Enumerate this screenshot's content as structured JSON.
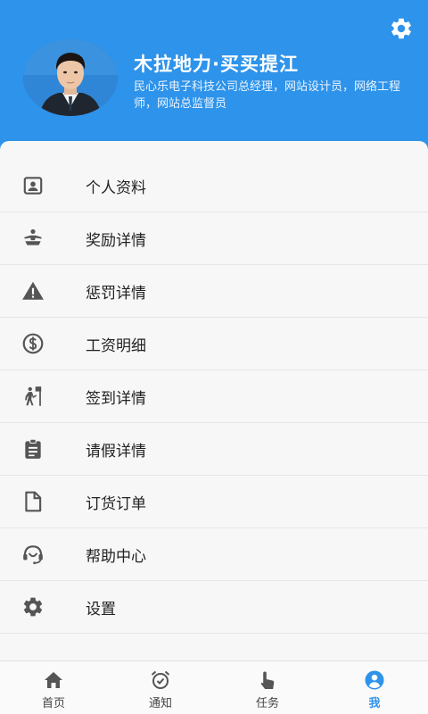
{
  "profile": {
    "name": "木拉地力·买买提江",
    "description": "民心乐电子科技公司总经理，网站设计员，网络工程师，网站总监督员"
  },
  "colors": {
    "header_bg": "#2e93ea",
    "icon_gray": "#555555",
    "active_tab": "#2e93ea"
  },
  "menu": {
    "items": [
      {
        "label": "个人资料",
        "icon": "id-card-icon"
      },
      {
        "label": "奖励详情",
        "icon": "award-icon"
      },
      {
        "label": "惩罚详情",
        "icon": "warning-icon"
      },
      {
        "label": "工资明细",
        "icon": "dollar-icon"
      },
      {
        "label": "签到详情",
        "icon": "checkin-icon"
      },
      {
        "label": "请假详情",
        "icon": "clipboard-icon"
      },
      {
        "label": "订货订单",
        "icon": "document-icon"
      },
      {
        "label": "帮助中心",
        "icon": "support-icon"
      },
      {
        "label": "设置",
        "icon": "gear-icon"
      }
    ]
  },
  "tabbar": {
    "tabs": [
      {
        "label": "首页",
        "icon": "home-icon",
        "active": false
      },
      {
        "label": "通知",
        "icon": "alarm-icon",
        "active": false
      },
      {
        "label": "任务",
        "icon": "tap-icon",
        "active": false
      },
      {
        "label": "我",
        "icon": "user-icon",
        "active": true
      }
    ]
  }
}
